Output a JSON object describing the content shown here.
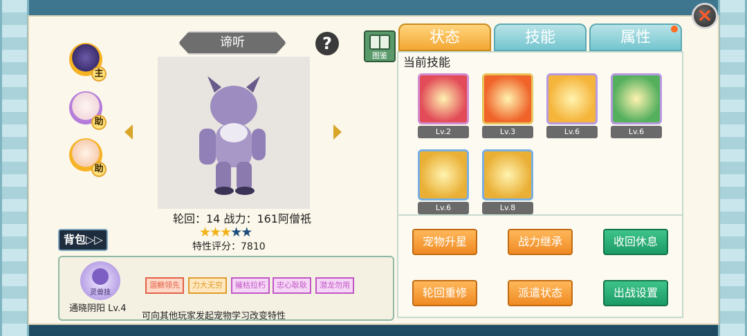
{
  "close_label": "×",
  "companions": [
    {
      "badge": "主",
      "icon": "dark-lion-avatar-icon",
      "ring": "#f6b323"
    },
    {
      "badge": "助",
      "icon": "rabbit-avatar-icon",
      "ring": "#b57cdb"
    },
    {
      "badge": "助",
      "icon": "fox-avatar-icon",
      "ring": "#f6b323"
    }
  ],
  "pet": {
    "name": "谛听",
    "help_label": "?",
    "atlas_label": "图鉴",
    "stats_text": "轮回：14   战力：161阿僧祇",
    "stars_filled": 3,
    "stars_total": 5,
    "score_text": "特性评分：7810"
  },
  "bag_label": "背包▷▷",
  "trait": {
    "name": "通晓阴阳 Lv.4",
    "emblem_text": "灵兽技",
    "hint": "可向其他玩家发起宠物学习改变特性",
    "chips": [
      {
        "label": "涸鲗领先",
        "color": "#e06048",
        "bg": "#ffd9c8"
      },
      {
        "label": "力大无穷",
        "color": "#e09b2c",
        "bg": "#ffe8bf"
      },
      {
        "label": "摧枯拉朽",
        "color": "#c057c5",
        "bg": "#f6d6f6"
      },
      {
        "label": "忠心耿耿",
        "color": "#c057c5",
        "bg": "#f6d6f6"
      },
      {
        "label": "潜龙勿用",
        "color": "#c057c5",
        "bg": "#f6d6f6"
      }
    ]
  },
  "tabs": [
    {
      "label": "状态",
      "active": true
    },
    {
      "label": "技能",
      "active": false
    },
    {
      "label": "属性",
      "active": false
    }
  ],
  "skills_title": "当前技能",
  "skills": [
    {
      "icon": "heart-burst-skill-icon",
      "level": "Lv.2",
      "border": "#d28ccf",
      "bg": "#e24b57"
    },
    {
      "icon": "fire-strike-skill-icon",
      "level": "Lv.3",
      "border": "#e8c25a",
      "bg": "#f0642a"
    },
    {
      "icon": "shadow-figure-skill-icon",
      "level": "Lv.6",
      "border": "#b699e0",
      "bg": "#f5b43a"
    },
    {
      "icon": "sword-shield-skill-icon",
      "level": "Lv.6",
      "border": "#b699e0",
      "bg": "#55b05e"
    },
    {
      "icon": "sword-rune-skill-icon",
      "level": "Lv.6",
      "border": "#78aee0",
      "bg": "#eab036"
    },
    {
      "icon": "crown-rune-skill-icon",
      "level": "Lv.8",
      "border": "#78aee0",
      "bg": "#eab036"
    }
  ],
  "actions": [
    {
      "label": "宠物升星",
      "style": "orange"
    },
    {
      "label": "战力继承",
      "style": "orange"
    },
    {
      "label": "收回休息",
      "style": "green"
    },
    {
      "label": "轮回重修",
      "style": "orange"
    },
    {
      "label": "派遣状态",
      "style": "orange"
    },
    {
      "label": "出战设置",
      "style": "green"
    }
  ]
}
